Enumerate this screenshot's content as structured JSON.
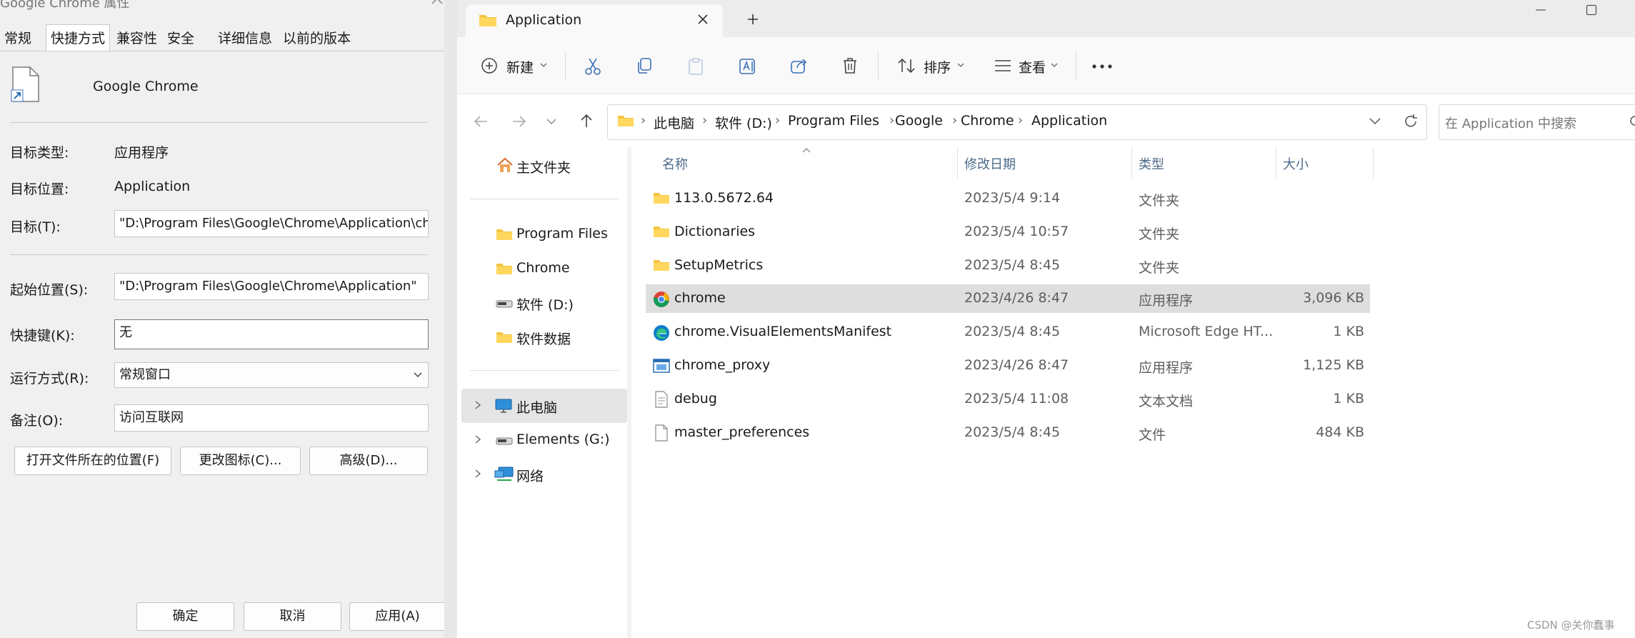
{
  "properties": {
    "title": "Google Chrome 属性",
    "tabs": [
      "常规",
      "快捷方式",
      "兼容性",
      "安全",
      "详细信息",
      "以前的版本"
    ],
    "active_tab": "快捷方式",
    "app_name": "Google Chrome",
    "rows": {
      "target_type_label": "目标类型:",
      "target_type_value": "应用程序",
      "target_location_label": "目标位置:",
      "target_location_value": "Application",
      "target_label": "目标(T):",
      "target_value": "\"D:\\Program Files\\Google\\Chrome\\Application\\ch",
      "start_in_label": "起始位置(S):",
      "start_in_value": "\"D:\\Program Files\\Google\\Chrome\\Application\"",
      "shortcut_key_label": "快捷键(K):",
      "shortcut_key_value": "无",
      "run_label": "运行方式(R):",
      "run_value": "常规窗口",
      "comment_label": "备注(O):",
      "comment_value": "访问互联网"
    },
    "buttons": {
      "open_location": "打开文件所在的位置(F)",
      "change_icon": "更改图标(C)...",
      "advanced": "高级(D)...",
      "ok": "确定",
      "cancel": "取消",
      "apply": "应用(A)"
    }
  },
  "explorer": {
    "tab_title": "Application",
    "toolbar": {
      "new": "新建",
      "sort": "排序",
      "view": "查看"
    },
    "breadcrumb": [
      "此电脑",
      "软件 (D:)",
      "Program Files",
      "Google",
      "Chrome",
      "Application"
    ],
    "search_placeholder": "在 Application 中搜索",
    "nav": {
      "home": "主文件夹",
      "pinned": [
        "Program Files",
        "Chrome",
        "软件 (D:)",
        "软件数据"
      ],
      "tree": [
        "此电脑",
        "Elements (G:)",
        "网络"
      ]
    },
    "columns": {
      "name": "名称",
      "date": "修改日期",
      "type": "类型",
      "size": "大小"
    },
    "files": [
      {
        "name": "113.0.5672.64",
        "date": "2023/5/4 9:14",
        "type": "文件夹",
        "size": "",
        "icon": "folder-icon"
      },
      {
        "name": "Dictionaries",
        "date": "2023/5/4 10:57",
        "type": "文件夹",
        "size": "",
        "icon": "folder-icon"
      },
      {
        "name": "SetupMetrics",
        "date": "2023/5/4 8:45",
        "type": "文件夹",
        "size": "",
        "icon": "folder-icon"
      },
      {
        "name": "chrome",
        "date": "2023/4/26 8:47",
        "type": "应用程序",
        "size": "3,096 KB",
        "icon": "chrome-icon"
      },
      {
        "name": "chrome.VisualElementsManifest",
        "date": "2023/5/4 8:45",
        "type": "Microsoft Edge HT...",
        "size": "1 KB",
        "icon": "edge-icon"
      },
      {
        "name": "chrome_proxy",
        "date": "2023/4/26 8:47",
        "type": "应用程序",
        "size": "1,125 KB",
        "icon": "app-window-icon"
      },
      {
        "name": "debug",
        "date": "2023/5/4 11:08",
        "type": "文本文档",
        "size": "1 KB",
        "icon": "text-file-icon"
      },
      {
        "name": "master_preferences",
        "date": "2023/5/4 8:45",
        "type": "文件",
        "size": "484 KB",
        "icon": "file-icon"
      }
    ],
    "selected_row": "chrome",
    "watermark": "CSDN @关你蠢事"
  }
}
